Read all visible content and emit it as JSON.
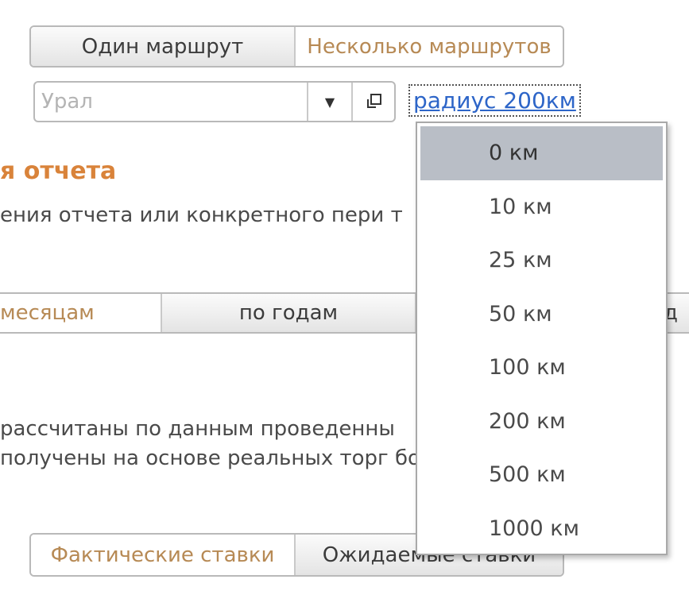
{
  "route_mode": {
    "options": [
      "Один маршрут",
      "Несколько маршрутов"
    ],
    "selected": "Один маршрут"
  },
  "region": {
    "placeholder": "Урал",
    "dropdown_icon": "triangle-down-icon",
    "open_icon": "open-window-icon"
  },
  "radius": {
    "link_label": "радиус 200км",
    "options": [
      "0 км",
      "10 км",
      "25 км",
      "50 км",
      "100 км",
      "200 км",
      "500 км",
      "1000 км"
    ],
    "highlighted": "0 км"
  },
  "report_section": {
    "title": "я отчета",
    "description": "ения отчета или конкретного пери                                              т"
  },
  "period_tabs": {
    "tabs": [
      "месяцам",
      "по годам",
      "д"
    ]
  },
  "notes": {
    "line1": "рассчитаны по данным проведенны",
    "line2": "получены на основе реальных торг                                               бо"
  },
  "rate_mode": {
    "options": [
      "Фактические ставки",
      "Ожидаемые ставки"
    ],
    "selected": "Ожидаемые ставки"
  },
  "colors": {
    "accent_orange": "#d9833a",
    "inactive_text": "#b78a55",
    "link_blue": "#2d65c8",
    "highlight": "#b9bec6"
  }
}
